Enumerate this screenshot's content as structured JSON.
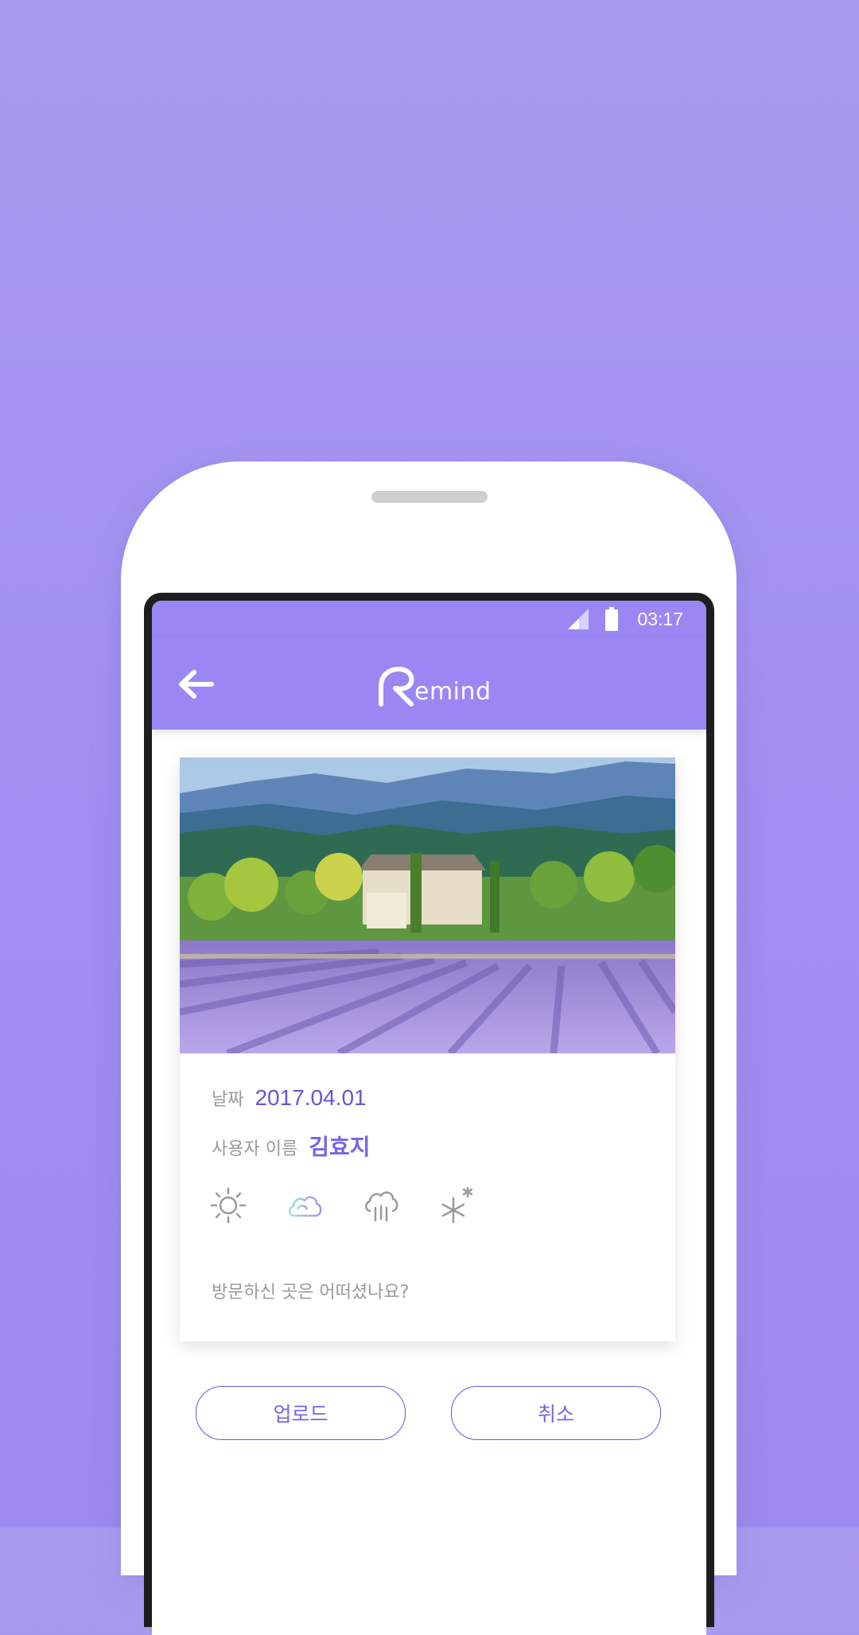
{
  "statusbar": {
    "time": "03:17",
    "signal_icon": "signal-icon",
    "battery_icon": "battery-icon"
  },
  "appbar": {
    "back_icon": "arrow-left-icon",
    "logo_text": "emind",
    "logo_letter": "R"
  },
  "card": {
    "photo_alt": "lavender-field-photo",
    "date_label": "날짜",
    "date_value": "2017.04.01",
    "user_label": "사용자 이름",
    "user_value": "김효지",
    "weather": [
      {
        "name": "sunny-icon",
        "selected": false
      },
      {
        "name": "cloudy-icon",
        "selected": true
      },
      {
        "name": "rain-icon",
        "selected": false
      },
      {
        "name": "snow-icon",
        "selected": false
      }
    ],
    "memo_placeholder": "방문하신 곳은 어떠셨나요?"
  },
  "buttons": {
    "upload": "업로드",
    "cancel": "취소"
  },
  "colors": {
    "accent": "#9b87f4",
    "accent_dark": "#6a52d8",
    "background": "#a99bf0"
  }
}
